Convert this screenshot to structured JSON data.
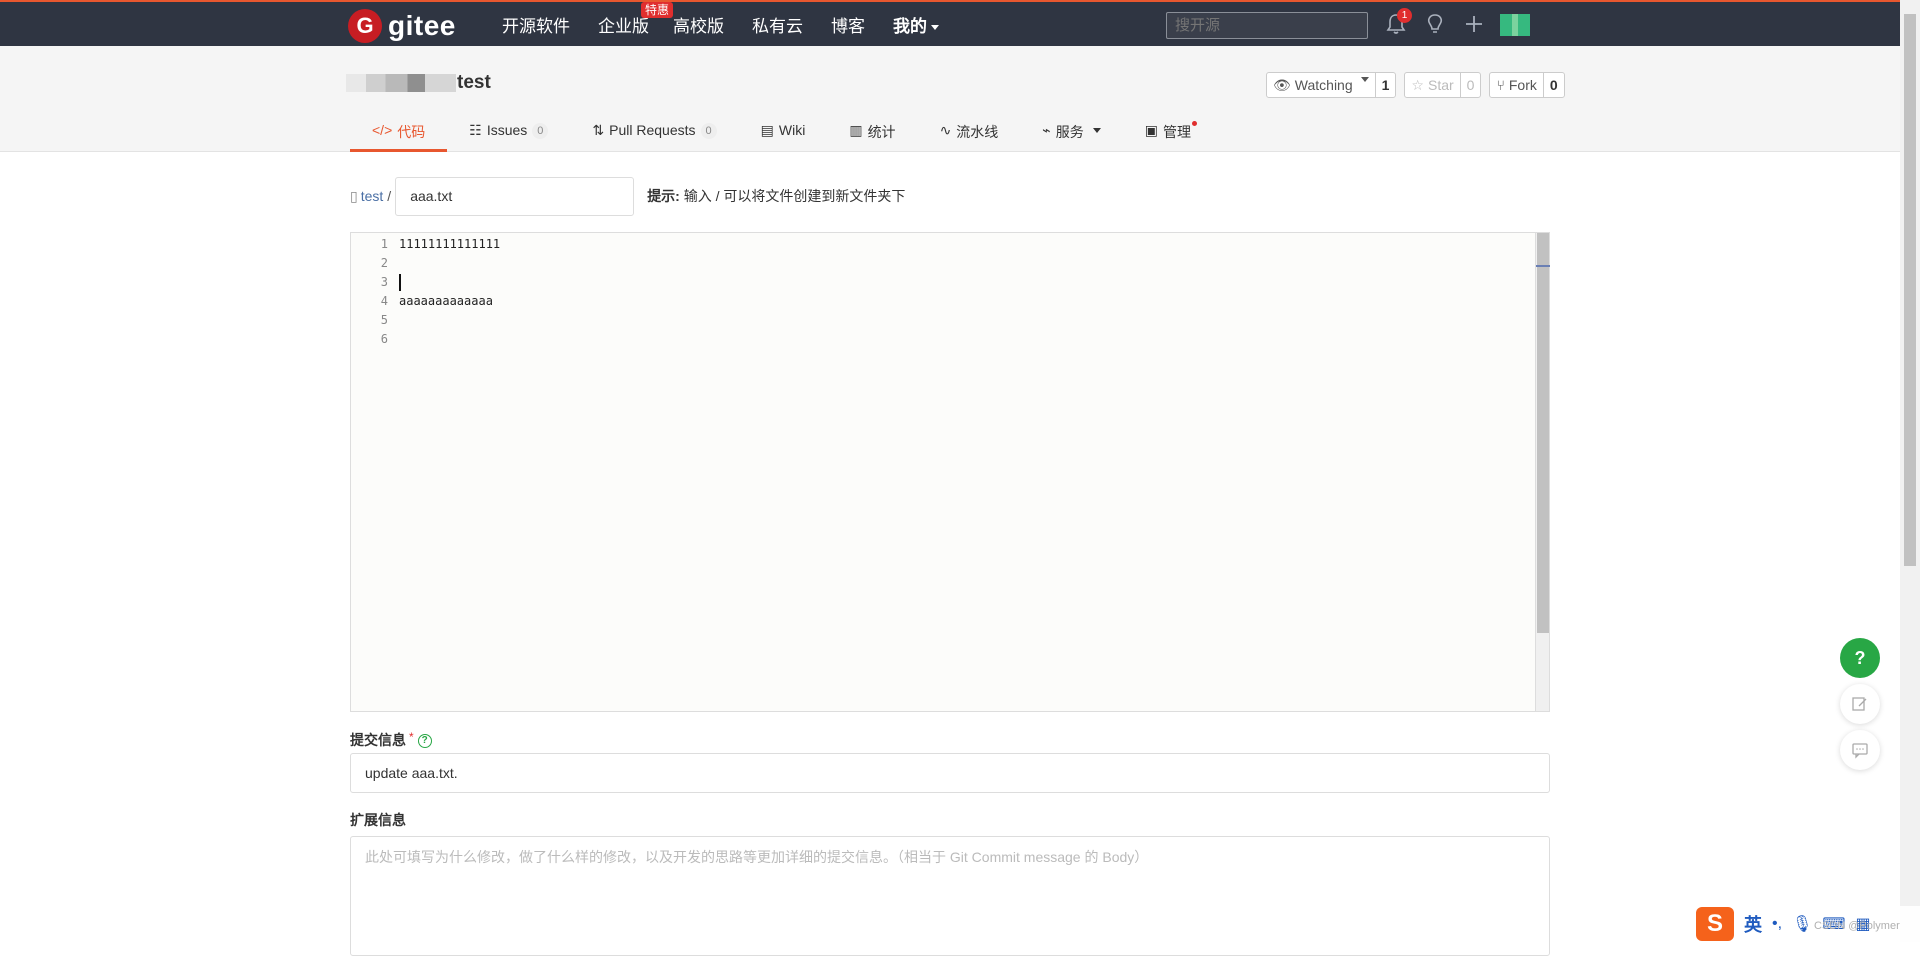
{
  "topnav": {
    "logo_mark": "G",
    "logo_text": "gitee",
    "links": [
      "开源软件",
      "企业版",
      "高校版",
      "私有云",
      "博客",
      "我的"
    ],
    "enterprise_badge": "特惠",
    "search_placeholder": "搜开源",
    "notification_count": "1",
    "icons": [
      "bell-icon",
      "lightbulb-icon",
      "plus-icon",
      "avatar"
    ]
  },
  "repo": {
    "name": "test",
    "actions": {
      "watching_label": "Watching",
      "watching_count": "1",
      "star_label": "Star",
      "star_count": "0",
      "fork_label": "Fork",
      "fork_count": "0"
    },
    "tabs": {
      "code": "代码",
      "issues": "Issues",
      "issues_count": "0",
      "pull_requests": "Pull Requests",
      "pull_requests_count": "0",
      "wiki": "Wiki",
      "stats": "统计",
      "pipeline": "流水线",
      "services": "服务",
      "manage": "管理"
    }
  },
  "path": {
    "repo": "test",
    "separator": "/",
    "filename": "aaa.txt",
    "hint_label": "提示:",
    "hint_text": "输入 / 可以将文件创建到新文件夹下"
  },
  "editor": {
    "line_numbers": [
      "1",
      "2",
      "3",
      "4",
      "5",
      "6"
    ],
    "lines": [
      "11111111111111",
      "",
      "",
      "aaaaaaaaaaaaa",
      "",
      ""
    ],
    "cursor_line": 3
  },
  "commit": {
    "label": "提交信息",
    "required_mark": "*",
    "message": "update aaa.txt.",
    "ext_label": "扩展信息",
    "ext_placeholder": "此处可填写为什么修改，做了什么样的修改，以及开发的思路等更加详细的提交信息。（相当于 Git Commit message 的 Body）"
  },
  "floating": {
    "help": "?",
    "icons": [
      "help-icon",
      "edit-icon",
      "comment-icon"
    ]
  },
  "ime": {
    "logo": "S",
    "lang": "英",
    "watermark": "CSDN @Polymer"
  },
  "colors": {
    "nav_bg": "#2f3542",
    "accent": "#e8572f",
    "brand_red": "#c71d23",
    "help_green": "#28a745"
  }
}
